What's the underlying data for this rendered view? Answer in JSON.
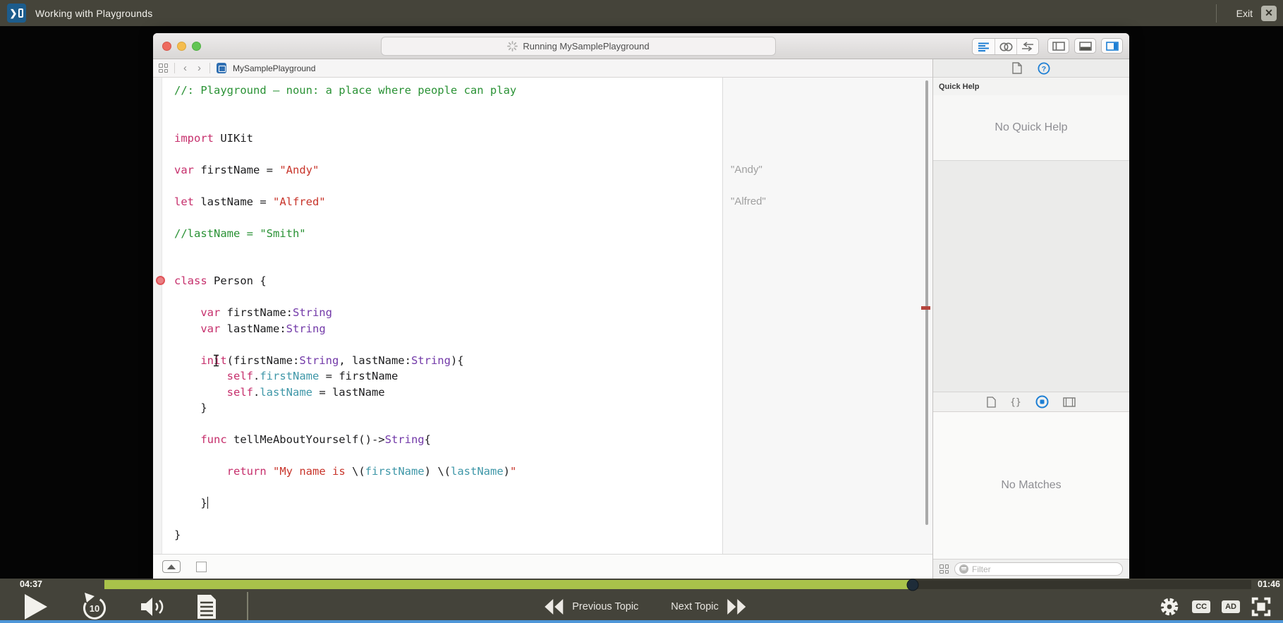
{
  "colors": {
    "accent_blue": "#1d7fd4",
    "progress_green": "#a9c24a",
    "focus_line_blue": "#4e96d8",
    "player_bar_bg": "#44433a",
    "keyword_pink": "#c62f6c",
    "comment_green": "#2a9235",
    "string_red": "#c8352b",
    "type_purple": "#7239a8",
    "property_teal": "#3f97a8"
  },
  "header": {
    "title": "Working with Playgrounds",
    "exit_label": "Exit",
    "close_icon": "x-icon"
  },
  "xcode": {
    "status_text": "Running MySamplePlayground",
    "tab_name": "MySamplePlayground",
    "toolbar_icons": [
      "standard-editor-icon",
      "assistant-editor-icon",
      "version-editor-icon",
      "navigator-panel-icon",
      "debug-area-icon",
      "inspector-panel-icon"
    ],
    "inspector": {
      "tab_icons": [
        "file-inspector-icon",
        "quick-help-icon"
      ],
      "quick_help_title": "Quick Help",
      "quick_help_empty": "No Quick Help",
      "library_icons": [
        "file-template-icon",
        "code-snippet-icon",
        "object-library-icon",
        "media-library-icon"
      ],
      "library_empty": "No Matches",
      "filter_placeholder": "Filter"
    }
  },
  "code": {
    "breakpoint_line": 12,
    "caret_line": 26,
    "cursor_line": 17,
    "results": [
      {
        "line": 5,
        "text": "\"Andy\""
      },
      {
        "line": 7,
        "text": "\"Alfred\""
      }
    ],
    "lines": [
      [
        {
          "s": "//: Playground – noun: a place where people can play",
          "c": "cm"
        }
      ],
      [],
      [],
      [
        {
          "s": "import",
          "c": "kw"
        },
        {
          "s": " UIKit",
          "c": "pl"
        }
      ],
      [],
      [
        {
          "s": "var",
          "c": "kw"
        },
        {
          "s": " firstName = ",
          "c": "pl"
        },
        {
          "s": "\"Andy\"",
          "c": "str"
        }
      ],
      [],
      [
        {
          "s": "let",
          "c": "kw"
        },
        {
          "s": " lastName = ",
          "c": "pl"
        },
        {
          "s": "\"Alfred\"",
          "c": "str"
        }
      ],
      [],
      [
        {
          "s": "//lastName = \"Smith\"",
          "c": "cm"
        }
      ],
      [],
      [],
      [
        {
          "s": "class",
          "c": "kw"
        },
        {
          "s": " Person {",
          "c": "pl"
        }
      ],
      [],
      [
        {
          "s": "    ",
          "c": "pl"
        },
        {
          "s": "var",
          "c": "kw"
        },
        {
          "s": " firstName:",
          "c": "pl"
        },
        {
          "s": "String",
          "c": "ty"
        }
      ],
      [
        {
          "s": "    ",
          "c": "pl"
        },
        {
          "s": "var",
          "c": "kw"
        },
        {
          "s": " lastName:",
          "c": "pl"
        },
        {
          "s": "String",
          "c": "ty"
        }
      ],
      [],
      [
        {
          "s": "    ",
          "c": "pl"
        },
        {
          "s": "init",
          "c": "kw"
        },
        {
          "s": "(firstName:",
          "c": "pl"
        },
        {
          "s": "String",
          "c": "ty"
        },
        {
          "s": ", lastName:",
          "c": "pl"
        },
        {
          "s": "String",
          "c": "ty"
        },
        {
          "s": "){",
          "c": "pl"
        }
      ],
      [
        {
          "s": "        ",
          "c": "pl"
        },
        {
          "s": "self",
          "c": "kw"
        },
        {
          "s": ".",
          "c": "pl"
        },
        {
          "s": "firstName",
          "c": "prop"
        },
        {
          "s": " = firstName",
          "c": "pl"
        }
      ],
      [
        {
          "s": "        ",
          "c": "pl"
        },
        {
          "s": "self",
          "c": "kw"
        },
        {
          "s": ".",
          "c": "pl"
        },
        {
          "s": "lastName",
          "c": "prop"
        },
        {
          "s": " = lastName",
          "c": "pl"
        }
      ],
      [
        {
          "s": "    }",
          "c": "pl"
        }
      ],
      [],
      [
        {
          "s": "    ",
          "c": "pl"
        },
        {
          "s": "func",
          "c": "kw"
        },
        {
          "s": " tellMeAboutYourself()->",
          "c": "pl"
        },
        {
          "s": "String",
          "c": "ty"
        },
        {
          "s": "{",
          "c": "pl"
        }
      ],
      [],
      [
        {
          "s": "        ",
          "c": "pl"
        },
        {
          "s": "return",
          "c": "kw"
        },
        {
          "s": " ",
          "c": "pl"
        },
        {
          "s": "\"My name is ",
          "c": "str"
        },
        {
          "s": "\\(",
          "c": "pl"
        },
        {
          "s": "firstName",
          "c": "prop"
        },
        {
          "s": ")",
          "c": "pl"
        },
        {
          "s": " ",
          "c": "str"
        },
        {
          "s": "\\(",
          "c": "pl"
        },
        {
          "s": "lastName",
          "c": "prop"
        },
        {
          "s": ")",
          "c": "pl"
        },
        {
          "s": "\"",
          "c": "str"
        }
      ],
      [],
      [
        {
          "s": "    }",
          "c": "pl"
        }
      ],
      [],
      [
        {
          "s": "}",
          "c": "pl"
        }
      ]
    ]
  },
  "player": {
    "elapsed": "04:37",
    "remaining": "01:46",
    "progress_pct": 70.5,
    "previous_label": "Previous Topic",
    "next_label": "Next Topic",
    "cc_label": "CC",
    "ad_label": "AD",
    "control_icons": [
      "play-icon",
      "rewind-10-icon",
      "volume-icon",
      "transcript-icon",
      "settings-gear-icon",
      "closed-captions-icon",
      "audio-description-icon",
      "fullscreen-icon"
    ]
  }
}
